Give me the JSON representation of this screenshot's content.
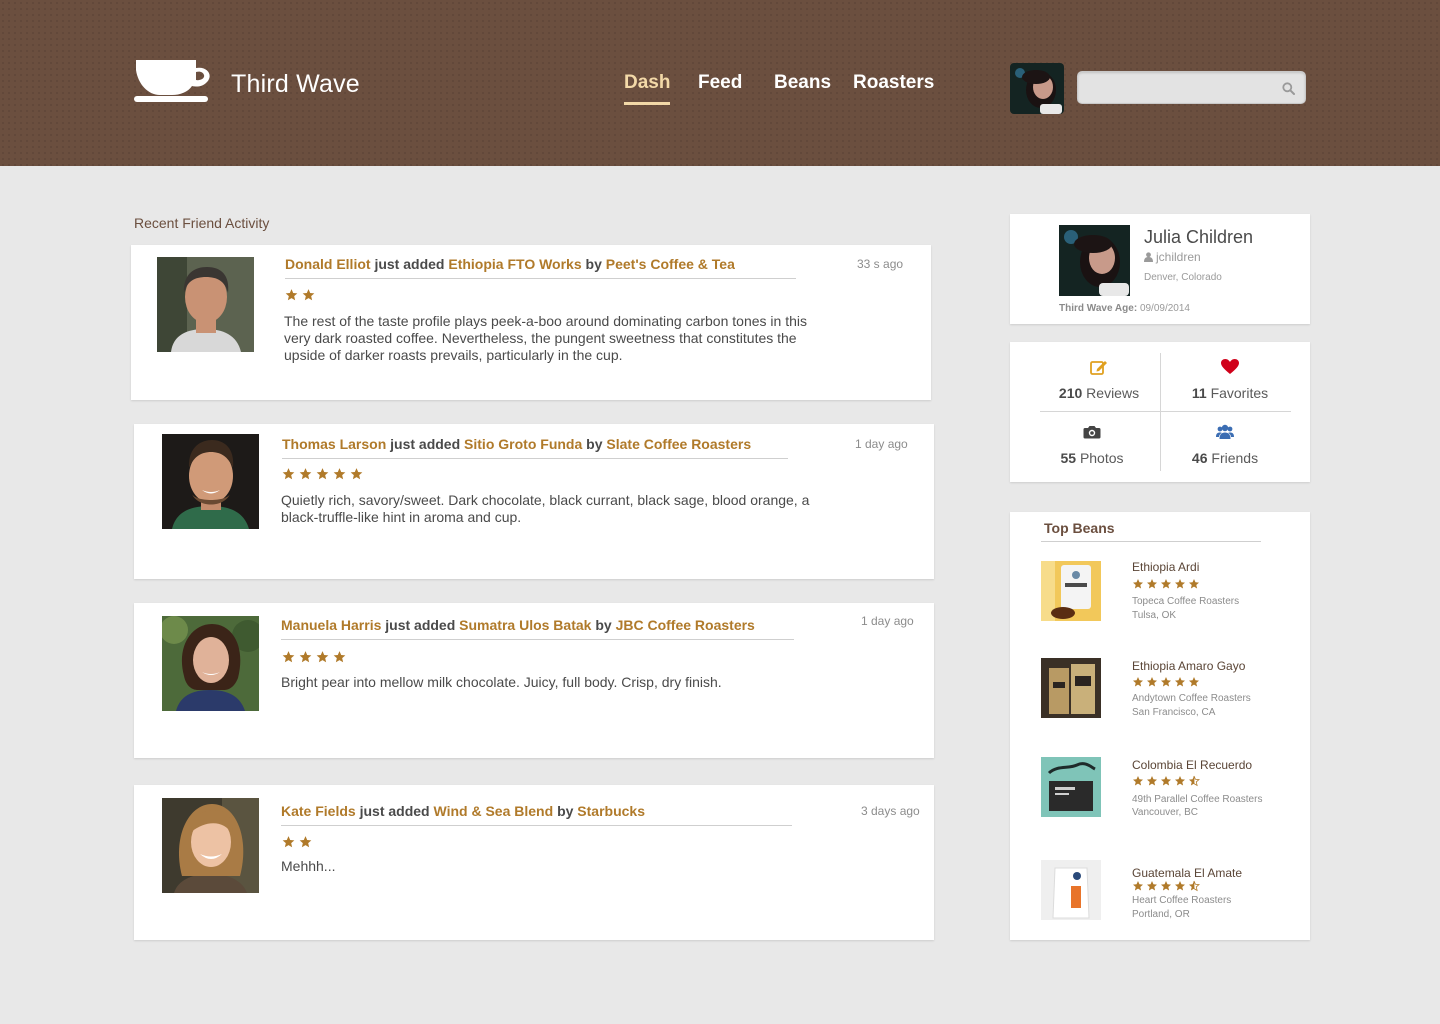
{
  "colors": {
    "brand_brown": "#6b4f3f",
    "link_gold": "#b07a2a",
    "nav_active": "#f3d9a8",
    "star": "#b07a2a",
    "heart": "#d0021b",
    "stat_icon_blue": "#3b6db3"
  },
  "header": {
    "app_title": "Third Wave",
    "logo_icon": "coffee-cup-icon",
    "nav": [
      "Dash",
      "Feed",
      "Beans",
      "Roasters"
    ],
    "active_nav": "Dash",
    "search": {
      "placeholder": "",
      "value": ""
    }
  },
  "feed": {
    "title": "Recent Friend Activity",
    "items": [
      {
        "user": "Donald Elliot",
        "verb": "just added",
        "bean": "Ethiopia FTO Works",
        "by": "by",
        "roaster": "Peet's Coffee & Tea",
        "time": "33 s ago",
        "rating": 2,
        "review": "The rest of the taste profile plays peek-a-boo around dominating carbon tones in this very dark roasted coffee. Nevertheless, the pungent sweetness that constitutes the upside of darker roasts prevails, particularly in the cup."
      },
      {
        "user": "Thomas Larson",
        "verb": "just added",
        "bean": "Sitio Groto Funda",
        "by": "by",
        "roaster": "Slate Coffee Roasters",
        "time": "1 day ago",
        "rating": 5,
        "review": "Quietly rich, savory/sweet. Dark chocolate, black currant, black sage, blood orange, a black-truffle-like hint in aroma and cup."
      },
      {
        "user": "Manuela Harris",
        "verb": "just added",
        "bean": "Sumatra Ulos Batak",
        "by": "by",
        "roaster": "JBC Coffee Roasters",
        "time": "1 day ago",
        "rating": 4,
        "review": "Bright pear into mellow milk chocolate. Juicy, full body. Crisp, dry finish."
      },
      {
        "user": "Kate Fields",
        "verb": "just added",
        "bean": "Wind & Sea Blend",
        "by": "by",
        "roaster": "Starbucks",
        "time": "3 days ago",
        "rating": 2,
        "review": "Mehhh..."
      }
    ]
  },
  "profile": {
    "name": "Julia Children",
    "handle": "jchildren",
    "location": "Denver, Colorado",
    "age_label": "Third Wave Age:",
    "age_value": "09/09/2014"
  },
  "stats": [
    {
      "count": "210",
      "label": "Reviews",
      "icon": "edit-icon"
    },
    {
      "count": "11",
      "label": "Favorites",
      "icon": "heart-icon"
    },
    {
      "count": "55",
      "label": "Photos",
      "icon": "camera-icon"
    },
    {
      "count": "46",
      "label": "Friends",
      "icon": "users-icon"
    }
  ],
  "top_beans": {
    "title": "Top Beans",
    "items": [
      {
        "name": "Ethiopia Ardi",
        "rating": 5,
        "roaster": "Topeca Coffee Roasters",
        "location": "Tulsa, OK"
      },
      {
        "name": "Ethiopia Amaro Gayo",
        "rating": 5,
        "roaster": "Andytown Coffee Roasters",
        "location": "San Francisco, CA"
      },
      {
        "name": "Colombia El Recuerdo",
        "rating": 4.5,
        "roaster": "49th Parallel Coffee Roasters",
        "location": "Vancouver, BC"
      },
      {
        "name": "Guatemala El Amate",
        "rating": 4.5,
        "roaster": "Heart Coffee Roasters",
        "location": "Portland, OR"
      }
    ]
  }
}
